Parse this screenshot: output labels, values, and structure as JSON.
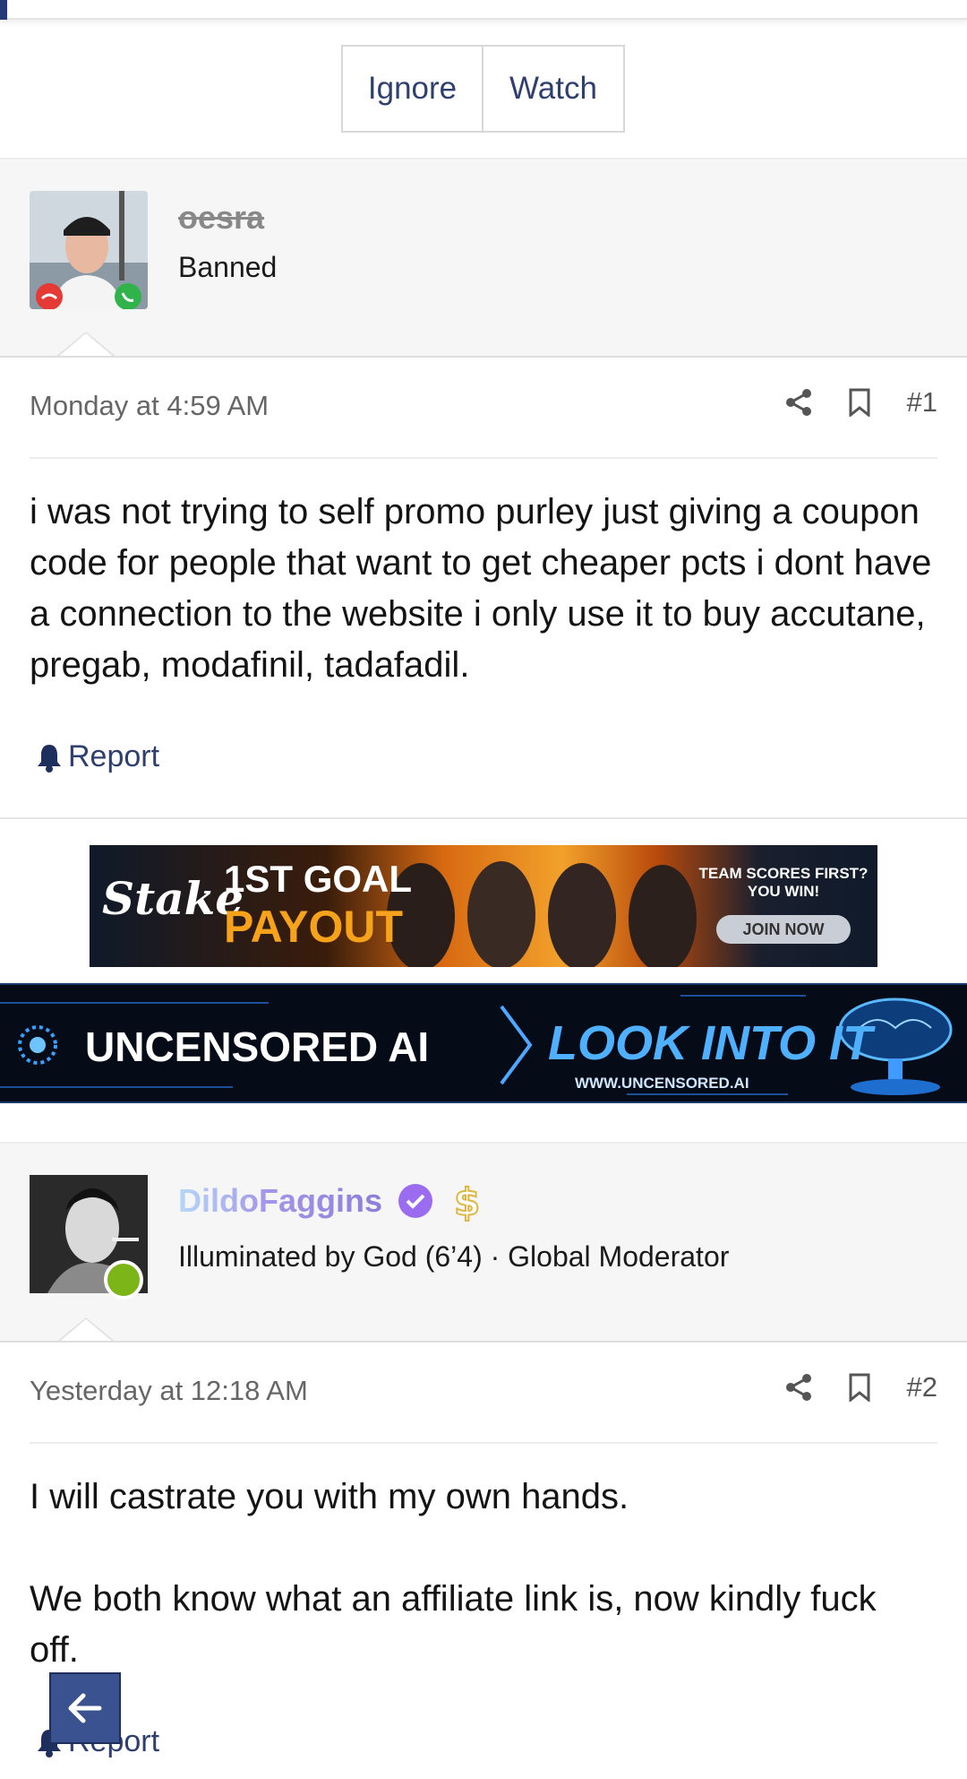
{
  "thread_actions": {
    "ignore_label": "Ignore",
    "watch_label": "Watch"
  },
  "posts": [
    {
      "username": "oesra",
      "user_title": "Banned",
      "timestamp": "Monday at 4:59 AM",
      "number": "#1",
      "body": "i was not trying to self promo purley just giving a coupon code for people that want to get cheaper pcts i dont have a connection to the website i only use it to buy accutane, pregab, modafinil, tadafadil.",
      "report_label": "Report"
    },
    {
      "username": "DildoFaggins",
      "user_title": "Illuminated by God (6’4) · Global Moderator",
      "timestamp": "Yesterday at 12:18 AM",
      "number": "#2",
      "body_lines": [
        "I will castrate you with my own hands.",
        "We both know what an affiliate link is, now kindly fuck off."
      ],
      "report_label": "Report"
    }
  ],
  "ads": [
    {
      "brand": "Stake",
      "headline_1": "1ST GOAL",
      "headline_2": "PAYOUT",
      "tagline": "TEAM SCORES FIRST? YOU WIN!",
      "cta": "JOIN NOW"
    },
    {
      "brand": "UNCENSORED AI",
      "cta": "LOOK INTO IT",
      "url": "WWW.UNCENSORED.AI"
    }
  ],
  "icons": {
    "share": "share-icon",
    "bookmark": "bookmark-icon",
    "bell": "bell-icon",
    "verified": "verified-badge-icon",
    "dollar": "dollar-icon",
    "back": "arrow-left-icon"
  },
  "colors": {
    "accent": "#2f3f6e",
    "moderator_name": "#8d7ed8",
    "online": "#7cb518",
    "banned_name": "#888888"
  }
}
